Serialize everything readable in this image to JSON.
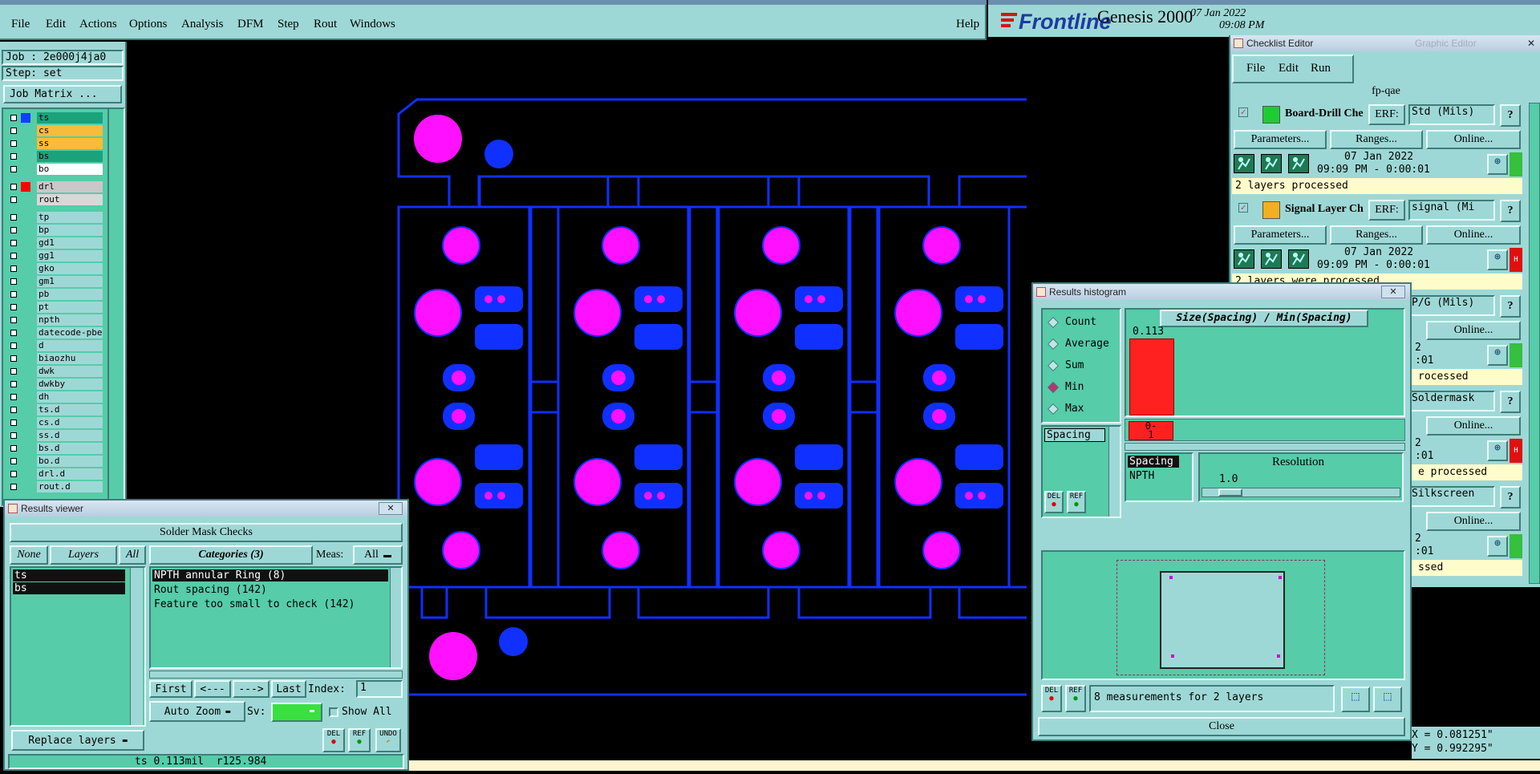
{
  "menu": {
    "items": [
      "File",
      "Edit",
      "Actions",
      "Options",
      "Analysis",
      "DFM",
      "Step",
      "Rout",
      "Windows"
    ],
    "help": "Help"
  },
  "brand": {
    "logo": "Frontline",
    "product": "Genesis 2000",
    "date": "07 Jan 2022",
    "time": "09:08 PM"
  },
  "job": {
    "job": "Job : 2e000j4ja0",
    "step": "Step: set",
    "matrix": "Job Matrix ..."
  },
  "layers": [
    {
      "name": "ts",
      "color": "#1aa37a",
      "swatch": "#1040ff"
    },
    {
      "name": "cs",
      "color": "#f7bc3b"
    },
    {
      "name": "ss",
      "color": "#f7bc3b"
    },
    {
      "name": "bs",
      "color": "#1aa37a"
    },
    {
      "name": "bo",
      "color": "#ffffff"
    },
    {
      "name": "drl",
      "color": "#c8c8c8",
      "swatch": "#ff0000"
    },
    {
      "name": "rout",
      "color": "#d8d8d8"
    },
    {
      "name": "tp"
    },
    {
      "name": "bp"
    },
    {
      "name": "gd1"
    },
    {
      "name": "gg1"
    },
    {
      "name": "gko"
    },
    {
      "name": "gm1"
    },
    {
      "name": "pb"
    },
    {
      "name": "pt"
    },
    {
      "name": "npth"
    },
    {
      "name": "datecode-pbe"
    },
    {
      "name": "d"
    },
    {
      "name": "biaozhu"
    },
    {
      "name": "dwk"
    },
    {
      "name": "dwkby"
    },
    {
      "name": "dh"
    },
    {
      "name": "ts.d"
    },
    {
      "name": "cs.d"
    },
    {
      "name": "ss.d"
    },
    {
      "name": "bs.d"
    },
    {
      "name": "bo.d"
    },
    {
      "name": "drl.d"
    },
    {
      "name": "rout.d"
    }
  ],
  "results_viewer": {
    "title": "Results viewer",
    "header": "Solder Mask Checks",
    "none": "None",
    "layers_btn": "Layers",
    "all": "All",
    "categories": "Categories (3)",
    "meas_label": "Meas:",
    "meas_value": "All",
    "layer_list": [
      "ts",
      "bs"
    ],
    "category_list": [
      "NPTH annular Ring (8)",
      "Rout spacing (142)",
      "Feature too small to check (142)"
    ],
    "first": "First",
    "prev": "<---",
    "next": "--->",
    "last": "Last",
    "index_label": "Index:",
    "index_value": "1",
    "auto_zoom": "Auto Zoom",
    "sv": "Sv:",
    "show_all": "Show All",
    "replace": "Replace layers",
    "del": "DEL",
    "ref": "REF",
    "undo": "UNDO",
    "status_layer": "ts",
    "status_value": "0.113mil",
    "status_r": "r125.984"
  },
  "checklist": {
    "title": "Checklist Editor",
    "ghost_title": "Graphic Editor",
    "menu": [
      "File",
      "Edit",
      "Run"
    ],
    "name": "fp-qae",
    "erf": "ERF:",
    "params": "Parameters...",
    "ranges": "Ranges...",
    "online": "Online...",
    "help": "?",
    "checks": [
      {
        "name": "Board-Drill Che",
        "erf": "Std (Mils)",
        "date": "07 Jan 2022",
        "time": "09:09 PM - 0:00:01",
        "status": "2 layers processed",
        "flag": "#35c03d"
      },
      {
        "name": "Signal Layer Ch",
        "erf": "signal (Mi",
        "date": "07 Jan 2022",
        "time": "09:09 PM - 0:00:01",
        "status": "2 layers were processed",
        "flag": "#e01010",
        "mark": "H"
      },
      {
        "erf": "P/G (Mils)",
        "date": "2",
        "time": ":01",
        "status": "rocessed",
        "flag": "#35c03d"
      },
      {
        "erf": "Soldermask",
        "date": "2",
        "time": ":01",
        "status": "e processed",
        "flag": "#e01010",
        "mark": "H"
      },
      {
        "erf": "Silkscreen",
        "date": "2",
        "time": ":01",
        "status": "ssed",
        "flag": "#35c03d"
      }
    ]
  },
  "histogram": {
    "title": "Results histogram",
    "options": [
      "Count",
      "Average",
      "Sum",
      "Min",
      "Max"
    ],
    "selected": "Min",
    "chart_title": "Size(Spacing) / Min(Spacing)",
    "value": "0.113",
    "bin": "0-",
    "bin2": "1",
    "attr_list": [
      "Spacing"
    ],
    "attr_list2": [
      "Spacing",
      "NPTH"
    ],
    "resolution_label": "Resolution",
    "resolution_value": "1.0",
    "summary": "8 measurements for 2 layers",
    "close": "Close",
    "del": "DEL",
    "ref": "REF"
  },
  "coords": {
    "x": "X = 0.081251\"",
    "y": "Y = 0.992295\""
  }
}
